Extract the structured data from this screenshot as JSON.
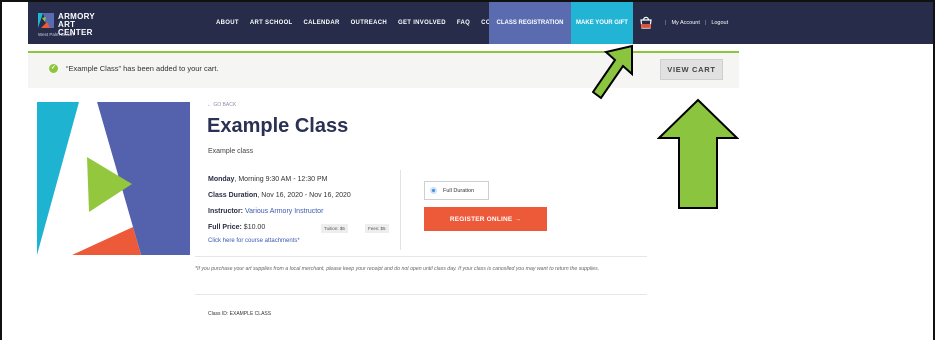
{
  "header": {
    "logo": {
      "line1": "ARMORY",
      "line2": "ART CENTER",
      "sub": "West Palm Beach"
    },
    "nav": [
      "ABOUT",
      "ART SCHOOL",
      "CALENDAR",
      "OUTREACH",
      "GET INVOLVED",
      "FAQ",
      "CONTACT"
    ],
    "class_registration": "CLASS REGISTRATION",
    "make_your_gift": "MAKE YOUR GIFT",
    "separator": "|",
    "my_account": "My Account",
    "logout": "Logout",
    "cart_icon": "shopping-bag-icon"
  },
  "notice": {
    "icon": "check-icon",
    "message": "“Example Class” has been added to your cart.",
    "view_cart": "VIEW CART"
  },
  "class": {
    "go_back": "← GO BACK",
    "title": "Example Class",
    "subtitle": "Example class",
    "day": "Monday",
    "time": ", Morning 9:30 AM - 12:30 PM",
    "duration_label": "Class Duration",
    "duration_value": ", Nov 16, 2020 - Nov 16, 2020",
    "instructor_label": "Instructor:",
    "instructor_value": "Various Armory Instructor",
    "price_label": "Full Price:",
    "price_value": "$10.00",
    "tuition": "Tuition: $5",
    "fees": "Fees: $5",
    "attachments": "Click here for course attachments*",
    "option": "Full Duration",
    "register": "REGISTER ONLINE →",
    "note": "*If you purchase your art supplies from a local merchant, please keep your receipt and do not open until class day. If your class is cancelled you may want to return the supplies.",
    "class_id": "Class ID: EXAMPLE CLASS"
  },
  "colors": {
    "header_bg": "#262c4a",
    "registration_bg": "#5a6bb0",
    "gift_bg": "#22b4d5",
    "accent_green": "#8fc43d",
    "register_bg": "#ec5a3a",
    "arrow_fill": "#8bc53f"
  }
}
